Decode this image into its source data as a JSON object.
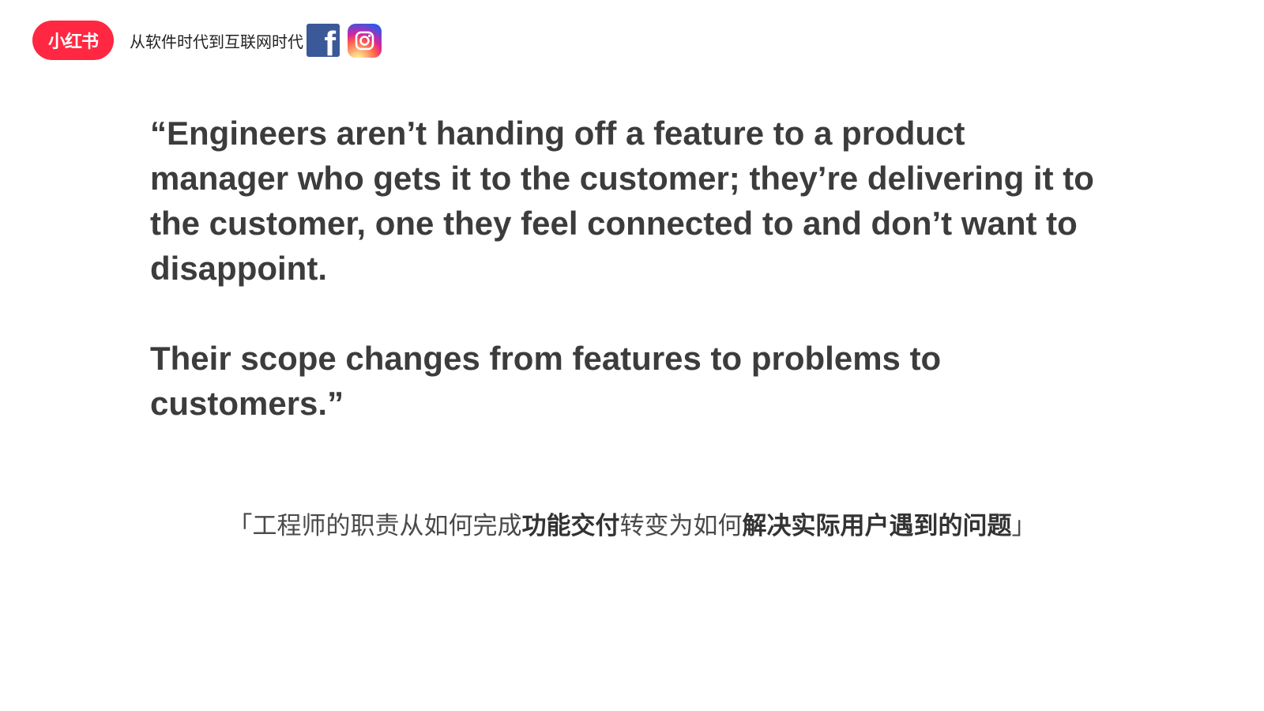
{
  "header": {
    "logo_text": "小红书",
    "tagline": "从软件时代到互联网时代",
    "facebook_glyph": "f",
    "facebook_icon": "facebook-icon",
    "instagram_icon": "instagram-icon"
  },
  "quote": {
    "paragraph_1": "“Engineers aren’t handing off a feature to a product manager who gets it to the customer; they’re delivering it to the customer, one they feel connected to and don’t want to disappoint.",
    "paragraph_2": " Their scope changes from features to problems to customers.”"
  },
  "translation": {
    "open_bracket": "「",
    "part_1": "工程师的职责从如何完成",
    "part_2_bold": "功能交付",
    "part_3": "转变为如何",
    "part_4_bold": "解决实际用户遇到的问题",
    "close_bracket": "」"
  },
  "colors": {
    "brand_red": "#ff2741",
    "facebook_blue": "#3b5998",
    "quote_text": "#3c3c3c",
    "background": "#ffffff"
  }
}
